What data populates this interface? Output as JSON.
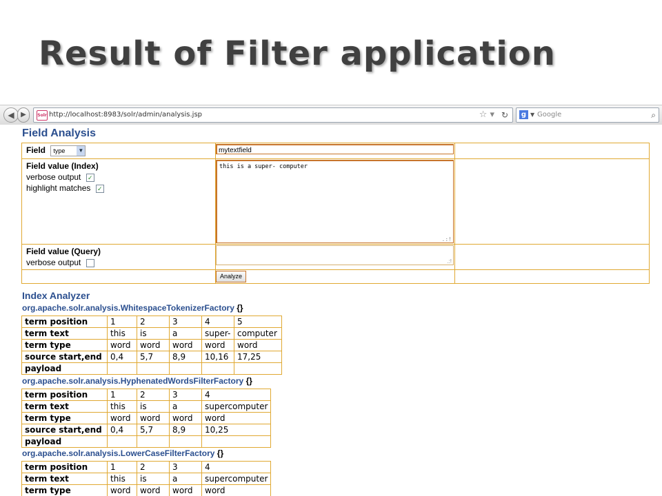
{
  "slide_title": "Result of Filter application",
  "browser": {
    "url": "http://localhost:8983/solr/admin/analysis.jsp",
    "favicon": "Solr",
    "search_placeholder": "Google"
  },
  "page": {
    "title": "Field Analysis",
    "field_label": "Field",
    "field_type": "type",
    "field_name": "mytextfield",
    "index_label": "Field value (Index)",
    "index_verbose": "verbose output",
    "index_highlight": "highlight matches",
    "index_value": "this is a super- computer",
    "query_label": "Field value (Query)",
    "query_verbose": "verbose output",
    "analyze_button": "Analyze",
    "index_analyzer": "Index Analyzer",
    "brace": "{}"
  },
  "row_labels": [
    "term position",
    "term text",
    "term type",
    "source start,end",
    "payload"
  ],
  "analyzers": [
    {
      "name": "org.apache.solr.analysis.WhitespaceTokenizerFactory",
      "positions": [
        "1",
        "2",
        "3",
        "4",
        "5"
      ],
      "texts": [
        "this",
        "is",
        "a",
        "super-",
        "computer"
      ],
      "types": [
        "word",
        "word",
        "word",
        "word",
        "word"
      ],
      "offsets": [
        "0,4",
        "5,7",
        "8,9",
        "10,16",
        "17,25"
      ]
    },
    {
      "name": "org.apache.solr.analysis.HyphenatedWordsFilterFactory",
      "positions": [
        "1",
        "2",
        "3",
        "4"
      ],
      "texts": [
        "this",
        "is",
        "a",
        "supercomputer"
      ],
      "types": [
        "word",
        "word",
        "word",
        "word"
      ],
      "offsets": [
        "0,4",
        "5,7",
        "8,9",
        "10,25"
      ]
    },
    {
      "name": "org.apache.solr.analysis.LowerCaseFilterFactory",
      "positions": [
        "1",
        "2",
        "3",
        "4"
      ],
      "texts": [
        "this",
        "is",
        "a",
        "supercomputer"
      ],
      "types": [
        "word",
        "word",
        "word",
        "word"
      ]
    }
  ]
}
